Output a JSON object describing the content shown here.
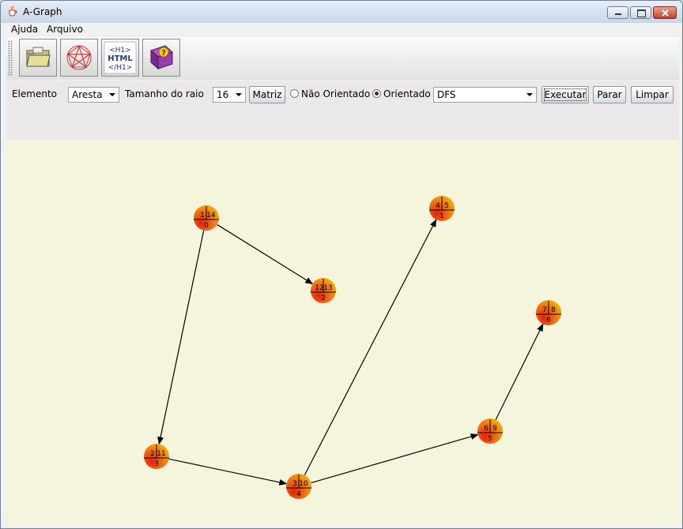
{
  "window": {
    "title": "A-Graph"
  },
  "menu": {
    "items": [
      "Ajuda",
      "Arquivo"
    ]
  },
  "toolbar": {
    "buttons": [
      {
        "icon": "folder-open-icon"
      },
      {
        "icon": "pentagram-graph-icon"
      },
      {
        "icon": "html-export-icon",
        "text": [
          "<H1>",
          "HTML",
          "</H1>"
        ]
      },
      {
        "icon": "help-book-icon",
        "text": "?"
      }
    ]
  },
  "controls": {
    "elemento_label": "Elemento",
    "elemento_value": "Aresta",
    "raio_label": "Tamanho do raio",
    "raio_value": "16",
    "matriz_label": "Matriz",
    "nao_orientado_label": "Não Orientado",
    "orientado_label": "Orientado",
    "orientado_selected": true,
    "algorithm_value": "DFS",
    "executar_label": "Executar",
    "parar_label": "Parar",
    "limpar_label": "Limpar"
  },
  "colors": {
    "canvas_bg": "#f5f4dc",
    "node_red": "#e8200a",
    "node_yellow": "#f5c400"
  },
  "graph": {
    "nodes": [
      {
        "id": "0",
        "tl": "1",
        "tr": "14",
        "bottom": "0"
      },
      {
        "id": "1",
        "tl": "4",
        "tr": "5",
        "bottom": "1"
      },
      {
        "id": "2",
        "tl": "12",
        "tr": "13",
        "bottom": "2"
      },
      {
        "id": "3",
        "tl": "2",
        "tr": "11",
        "bottom": "3"
      },
      {
        "id": "4",
        "tl": "3",
        "tr": "10",
        "bottom": "4"
      },
      {
        "id": "5",
        "tl": "6",
        "tr": "9",
        "bottom": "5"
      },
      {
        "id": "6",
        "tl": "7",
        "tr": "8",
        "bottom": "6"
      }
    ],
    "edges": [
      {
        "from": "0",
        "to": "2"
      },
      {
        "from": "0",
        "to": "3"
      },
      {
        "from": "3",
        "to": "4"
      },
      {
        "from": "4",
        "to": "1"
      },
      {
        "from": "4",
        "to": "5"
      },
      {
        "from": "5",
        "to": "6"
      }
    ]
  }
}
